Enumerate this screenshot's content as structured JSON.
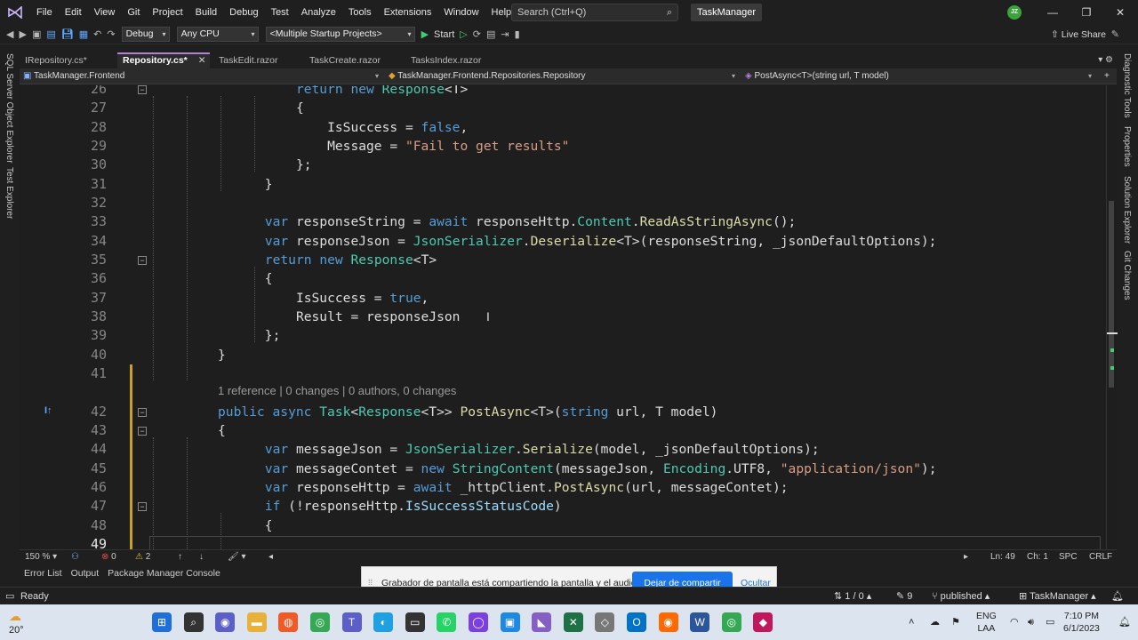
{
  "menu": [
    "File",
    "Edit",
    "View",
    "Git",
    "Project",
    "Build",
    "Debug",
    "Test",
    "Analyze",
    "Tools",
    "Extensions",
    "Window",
    "Help"
  ],
  "search": {
    "placeholder": "Search (Ctrl+Q)"
  },
  "solution_title": "TaskManager",
  "user_initials": "JZ",
  "toolbar": {
    "config": "Debug",
    "platform": "Any CPU",
    "startup": "<Multiple Startup Projects>",
    "start": "Start",
    "live_share": "Live Share"
  },
  "left_panels": [
    "SQL Server Object Explorer",
    "Test Explorer"
  ],
  "right_panels": [
    "Diagnostic Tools",
    "Properties",
    "Solution Explorer",
    "Git Changes"
  ],
  "tabs": [
    {
      "label": "IRepository.cs*",
      "active": false
    },
    {
      "label": "Repository.cs*",
      "active": true
    },
    {
      "label": "TaskEdit.razor",
      "active": false
    },
    {
      "label": "TaskCreate.razor",
      "active": false
    },
    {
      "label": "TasksIndex.razor",
      "active": false
    }
  ],
  "navbar": {
    "project": "TaskManager.Frontend",
    "type": "TaskManager.Frontend.Repositories.Repository",
    "member": "PostAsync<T>(string url, T model)"
  },
  "codelens": "1 reference | 0 changes | 0 authors, 0 changes",
  "lines": [
    {
      "n": "26",
      "tokens": [
        [
          "        ",
          "p"
        ],
        [
          "return",
          "kw"
        ],
        [
          " ",
          "p"
        ],
        [
          "new",
          "kw"
        ],
        [
          " ",
          "p"
        ],
        [
          "Response",
          "ty"
        ],
        [
          "<T>",
          "p"
        ]
      ]
    },
    {
      "n": "27",
      "tokens": [
        [
          "        {",
          "p"
        ]
      ]
    },
    {
      "n": "28",
      "tokens": [
        [
          "            IsSuccess = ",
          "p"
        ],
        [
          "false",
          "kw"
        ],
        [
          ",",
          "p"
        ]
      ]
    },
    {
      "n": "29",
      "tokens": [
        [
          "            Message = ",
          "p"
        ],
        [
          "\"Fail to get results\"",
          "str"
        ]
      ]
    },
    {
      "n": "30",
      "tokens": [
        [
          "        };",
          "p"
        ]
      ]
    },
    {
      "n": "31",
      "tokens": [
        [
          "    }",
          "p"
        ]
      ]
    },
    {
      "n": "32",
      "tokens": [
        [
          "",
          "p"
        ]
      ]
    },
    {
      "n": "33",
      "tokens": [
        [
          "    ",
          "p"
        ],
        [
          "var",
          "kw"
        ],
        [
          " responseString = ",
          "p"
        ],
        [
          "await",
          "kw"
        ],
        [
          " responseHttp.",
          "p"
        ],
        [
          "Content",
          "ty"
        ],
        [
          ".",
          "p"
        ],
        [
          "ReadAsStringAsync",
          "m"
        ],
        [
          "();",
          "p"
        ]
      ]
    },
    {
      "n": "34",
      "tokens": [
        [
          "    ",
          "p"
        ],
        [
          "var",
          "kw"
        ],
        [
          " responseJson = ",
          "p"
        ],
        [
          "JsonSerializer",
          "ty"
        ],
        [
          ".",
          "p"
        ],
        [
          "Deserialize",
          "m"
        ],
        [
          "<T>(responseString, _jsonDefaultOptions);",
          "p"
        ]
      ]
    },
    {
      "n": "35",
      "tokens": [
        [
          "    ",
          "p"
        ],
        [
          "return",
          "kw"
        ],
        [
          " ",
          "p"
        ],
        [
          "new",
          "kw"
        ],
        [
          " ",
          "p"
        ],
        [
          "Response",
          "ty"
        ],
        [
          "<T>",
          "p"
        ]
      ]
    },
    {
      "n": "36",
      "tokens": [
        [
          "    {",
          "p"
        ]
      ]
    },
    {
      "n": "37",
      "tokens": [
        [
          "        IsSuccess = ",
          "p"
        ],
        [
          "true",
          "kw"
        ],
        [
          ",",
          "p"
        ]
      ]
    },
    {
      "n": "38",
      "tokens": [
        [
          "        Result = responseJson",
          "p"
        ]
      ]
    },
    {
      "n": "39",
      "tokens": [
        [
          "    };",
          "p"
        ]
      ]
    },
    {
      "n": "40",
      "tokens": [
        [
          "}",
          "p"
        ]
      ]
    },
    {
      "n": "41",
      "tokens": [
        [
          "",
          "p"
        ]
      ]
    },
    {
      "n": "42",
      "tokens": [
        [
          "public",
          "kw"
        ],
        [
          " ",
          "p"
        ],
        [
          "async",
          "kw"
        ],
        [
          " ",
          "p"
        ],
        [
          "Task",
          "ty"
        ],
        [
          "<",
          "p"
        ],
        [
          "Response",
          "ty"
        ],
        [
          "<T>> ",
          "p"
        ],
        [
          "PostAsync",
          "m"
        ],
        [
          "<T>(",
          "p"
        ],
        [
          "string",
          "kw"
        ],
        [
          " url, T model)",
          "p"
        ]
      ]
    },
    {
      "n": "43",
      "tokens": [
        [
          "{",
          "p"
        ]
      ]
    },
    {
      "n": "44",
      "tokens": [
        [
          "    ",
          "p"
        ],
        [
          "var",
          "kw"
        ],
        [
          " messageJson = ",
          "p"
        ],
        [
          "JsonSerializer",
          "ty"
        ],
        [
          ".",
          "p"
        ],
        [
          "Serialize",
          "m"
        ],
        [
          "(model, _jsonDefaultOptions);",
          "p"
        ]
      ]
    },
    {
      "n": "45",
      "tokens": [
        [
          "    ",
          "p"
        ],
        [
          "var",
          "kw"
        ],
        [
          " messageContet = ",
          "p"
        ],
        [
          "new",
          "kw"
        ],
        [
          " ",
          "p"
        ],
        [
          "StringContent",
          "ty"
        ],
        [
          "(messageJson, ",
          "p"
        ],
        [
          "Encoding",
          "ty"
        ],
        [
          ".UTF8, ",
          "p"
        ],
        [
          "\"application/json\"",
          "str"
        ],
        [
          ");",
          "p"
        ]
      ]
    },
    {
      "n": "46",
      "tokens": [
        [
          "    ",
          "p"
        ],
        [
          "var",
          "kw"
        ],
        [
          " responseHttp = ",
          "p"
        ],
        [
          "await",
          "kw"
        ],
        [
          " _httpClient.",
          "p"
        ],
        [
          "PostAsync",
          "m"
        ],
        [
          "(url, messageContet);",
          "p"
        ]
      ]
    },
    {
      "n": "47",
      "tokens": [
        [
          "    ",
          "p"
        ],
        [
          "if",
          "kw"
        ],
        [
          " (!responseHttp.",
          "p"
        ],
        [
          "IsSuccessStatusCode",
          "v"
        ],
        [
          ")",
          "p"
        ]
      ]
    },
    {
      "n": "48",
      "tokens": [
        [
          "    {",
          "p"
        ]
      ]
    },
    {
      "n": "49",
      "tokens": [
        [
          "",
          "p"
        ]
      ]
    }
  ],
  "editor_status": {
    "zoom": "150 %",
    "errors": "0",
    "warnings": "2",
    "ln": "Ln: 49",
    "ch": "Ch: 1",
    "spc": "SPC",
    "crlf": "CRLF"
  },
  "bottom_tabs": [
    "Error List",
    "Output",
    "Package Manager Console"
  ],
  "share": {
    "message": "Grabador de pantalla está compartiendo la pantalla y el audio.",
    "button": "Dejar de compartir",
    "hide": "Ocultar"
  },
  "status": {
    "ready": "Ready",
    "lines": "1 / 0",
    "pencil": "9",
    "branch": "published",
    "repo": "TaskManager"
  },
  "taskbar": {
    "temp": "20°",
    "lang": "ENG",
    "region": "LAA",
    "time": "7:10 PM",
    "date": "6/1/2023"
  }
}
